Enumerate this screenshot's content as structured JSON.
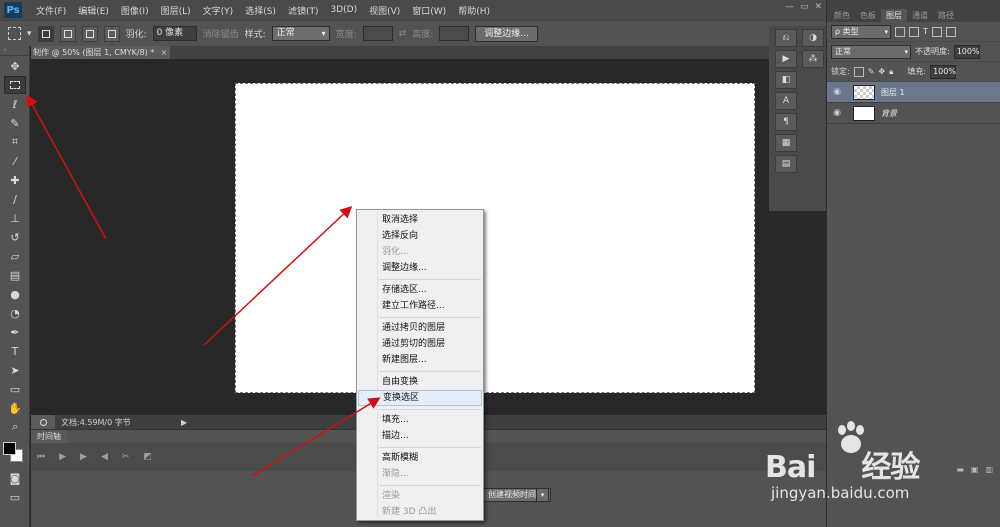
{
  "app": {
    "logo": "Ps",
    "menu": [
      "文件(F)",
      "编辑(E)",
      "图像(I)",
      "图层(L)",
      "文字(Y)",
      "选择(S)",
      "滤镜(T)",
      "3D(D)",
      "视图(V)",
      "窗口(W)",
      "帮助(H)"
    ],
    "window_controls": {
      "minimize": "—",
      "restore": "▭",
      "close": "✕"
    }
  },
  "options_bar": {
    "feather_label": "羽化:",
    "feather_value": "0 像素",
    "antialias_label": "消除锯齿",
    "style_label": "样式:",
    "style_value": "正常",
    "width_label": "宽度:",
    "height_label": "高度:",
    "refine_button": "调整边缘..."
  },
  "document": {
    "tab_label": "制作 @ 50% (图层 1, CMYK/8) *",
    "tab_close": "×",
    "status_text": "文档:4.59M/0 字节",
    "status_arrow": "▶"
  },
  "timeline": {
    "tab_label": "时间轴",
    "create_button": "创建视频时间轴",
    "dropdown": "▾"
  },
  "layers_panel": {
    "tabs": [
      "颜色",
      "色板",
      "图层",
      "通道",
      "路径"
    ],
    "active_tab": "图层",
    "filter_label": "ρ 类型",
    "blend_mode": "正常",
    "opacity_label": "不透明度:",
    "opacity_value": "100%",
    "lock_label": "锁定:",
    "fill_label": "填充:",
    "fill_value": "100%",
    "layers": [
      {
        "name": "图层 1",
        "selected": true
      },
      {
        "name": "背景",
        "selected": false
      }
    ]
  },
  "context_menu": {
    "items": [
      {
        "label": "取消选择",
        "disabled": false
      },
      {
        "label": "选择反向",
        "disabled": false
      },
      {
        "label": "羽化...",
        "disabled": true
      },
      {
        "label": "调整边缘...",
        "disabled": false
      },
      {
        "label": "存储选区...",
        "disabled": false
      },
      {
        "label": "建立工作路径...",
        "disabled": false
      },
      {
        "label": "通过拷贝的图层",
        "disabled": false
      },
      {
        "label": "通过剪切的图层",
        "disabled": false
      },
      {
        "label": "新建图层...",
        "disabled": false
      },
      {
        "label": "自由变换",
        "disabled": false
      },
      {
        "label": "变换选区",
        "disabled": false,
        "hover": true
      },
      {
        "label": "填充...",
        "disabled": false
      },
      {
        "label": "描边...",
        "disabled": false
      },
      {
        "label": "高斯模糊",
        "disabled": false
      },
      {
        "label": "渐隐...",
        "disabled": true
      },
      {
        "label": "渲染",
        "disabled": true
      },
      {
        "label": "新建 3D 凸出",
        "disabled": true
      }
    ]
  },
  "watermark": {
    "brand_left": "Bai",
    "brand_right": "经验",
    "url": "jingyan.baidu.com"
  },
  "colors": {
    "annotation_arrow": "#d01010",
    "selected_layer": "#6b778e",
    "menu_hover": "#e4edf8"
  }
}
